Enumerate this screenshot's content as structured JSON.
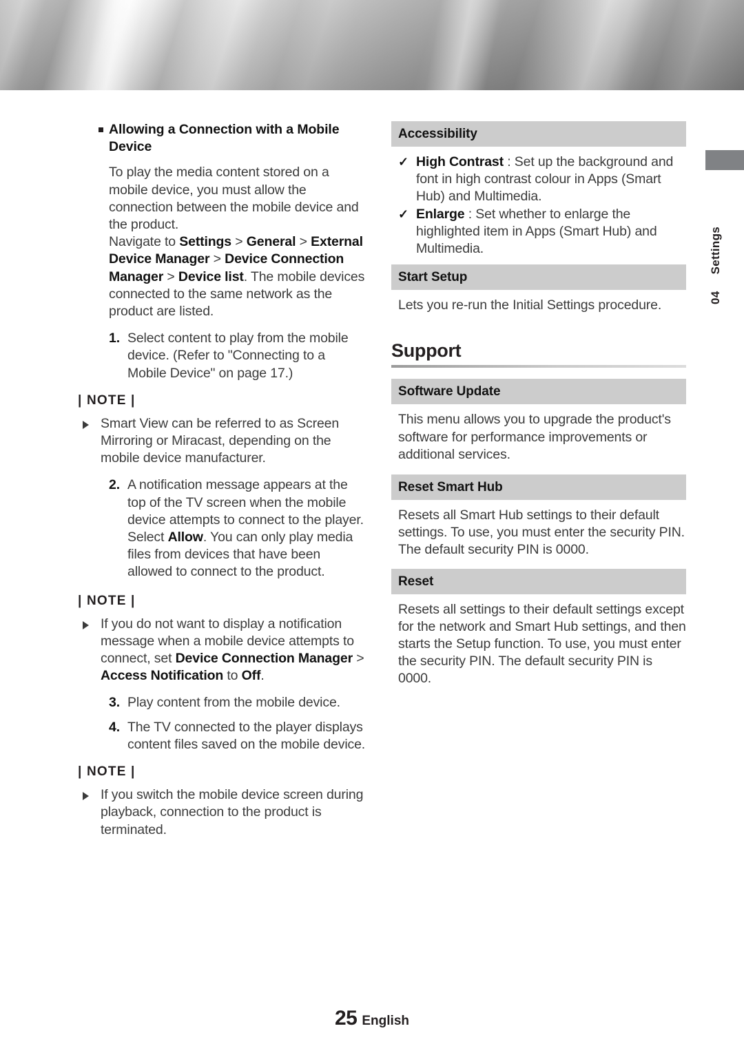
{
  "page": {
    "number": "25",
    "language": "English",
    "chapter_number": "04",
    "chapter_name": "Settings"
  },
  "left_column": {
    "heading": "Allowing a Connection with a Mobile Device",
    "intro_paragraph": "To play the media content stored on a mobile device, you must allow the connection between the mobile device and the product.",
    "navigate_paragraph_prefix": "Navigate to ",
    "navigate_path_1": "Settings",
    "navigate_sep_1": " > ",
    "navigate_path_2": "General",
    "navigate_sep_2": " > ",
    "navigate_path_3": "External Device Manager",
    "navigate_sep_3": " > ",
    "navigate_path_4": "Device Connection Manager",
    "navigate_sep_4": " > ",
    "navigate_path_5": "Device list",
    "navigate_paragraph_suffix": ". The mobile devices connected to the same network as the product are listed.",
    "step_1_num": "1.",
    "step_1_text": "Select content to play from the mobile device. (Refer to \"Connecting to a Mobile Device\" on page 17.)",
    "note_label_1": "| NOTE |",
    "note_1_text": "Smart View can be referred to as Screen Mirroring or Miracast, depending on the mobile device manufacturer.",
    "step_2_num": "2.",
    "step_2_text_a": "A notification message appears at the top of the TV screen when the mobile device attempts to connect to the player. Select ",
    "step_2_bold": "Allow",
    "step_2_text_b": ". You can only play media files from devices that have been allowed to connect to the product.",
    "note_label_2": "| NOTE |",
    "note_2_text_a": "If you do not want to display a notification message when a mobile device attempts to connect, set ",
    "note_2_bold_1": "Device Connection Manager",
    "note_2_text_b": " > ",
    "note_2_bold_2": "Access Notification",
    "note_2_text_c": " to ",
    "note_2_bold_3": "Off",
    "note_2_text_d": ".",
    "step_3_num": "3.",
    "step_3_text": "Play content from the mobile device.",
    "step_4_num": "4.",
    "step_4_text": "The TV connected to the player displays content files saved on the mobile device.",
    "note_label_3": "| NOTE |",
    "note_3_text": "If you switch the mobile device screen during playback, connection to the product is terminated."
  },
  "right_column": {
    "accessibility_header": "Accessibility",
    "high_contrast_check": "✓",
    "high_contrast_term": "High Contrast",
    "high_contrast_desc": " : Set up the background and font in high contrast colour in Apps (Smart Hub) and Multimedia.",
    "enlarge_check": "✓",
    "enlarge_term": "Enlarge",
    "enlarge_desc": " : Set whether to enlarge the highlighted item in Apps (Smart Hub) and Multimedia.",
    "start_setup_header": "Start Setup",
    "start_setup_body": "Lets you re-run the Initial Settings procedure.",
    "support_heading": "Support",
    "software_update_header": "Software Update",
    "software_update_body": "This menu allows you to upgrade the product's software for performance improvements or additional services.",
    "reset_smart_hub_header": "Reset Smart Hub",
    "reset_smart_hub_body": "Resets all Smart Hub settings to their default settings. To use, you must enter the security PIN. The default security PIN is 0000.",
    "reset_header": "Reset",
    "reset_body": "Resets all settings to their default settings except for the network and Smart Hub settings, and then starts the Setup function. To use, you must enter the security PIN. The default security PIN is 0000."
  },
  "colors": {
    "section_bar": "#cccccc",
    "tab_block": "#808285",
    "body_text": "#3b3b3b",
    "heading_text": "#231f20"
  }
}
